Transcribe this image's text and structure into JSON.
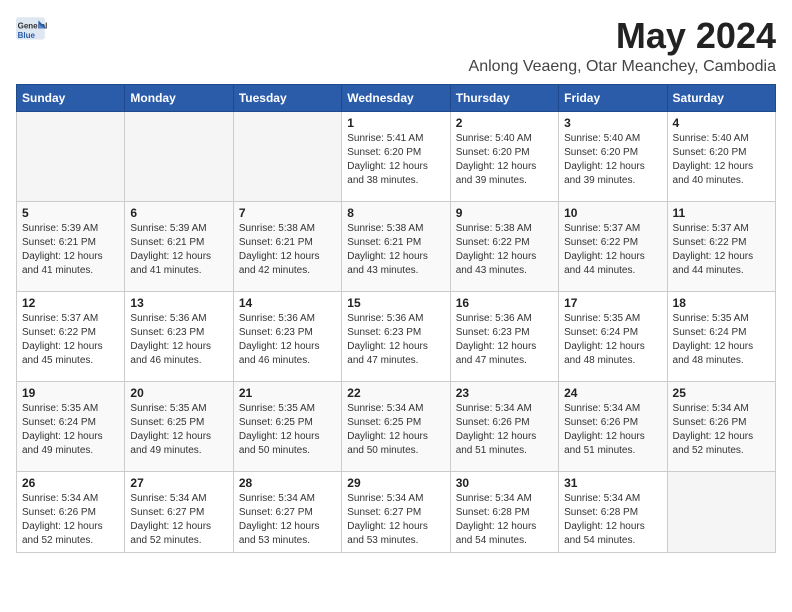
{
  "header": {
    "logo_general": "General",
    "logo_blue": "Blue",
    "title": "May 2024",
    "location": "Anlong Veaeng, Otar Meanchey, Cambodia"
  },
  "weekdays": [
    "Sunday",
    "Monday",
    "Tuesday",
    "Wednesday",
    "Thursday",
    "Friday",
    "Saturday"
  ],
  "weeks": [
    [
      {
        "day": "",
        "sunrise": "",
        "sunset": "",
        "daylight": ""
      },
      {
        "day": "",
        "sunrise": "",
        "sunset": "",
        "daylight": ""
      },
      {
        "day": "",
        "sunrise": "",
        "sunset": "",
        "daylight": ""
      },
      {
        "day": "1",
        "sunrise": "Sunrise: 5:41 AM",
        "sunset": "Sunset: 6:20 PM",
        "daylight": "Daylight: 12 hours and 38 minutes."
      },
      {
        "day": "2",
        "sunrise": "Sunrise: 5:40 AM",
        "sunset": "Sunset: 6:20 PM",
        "daylight": "Daylight: 12 hours and 39 minutes."
      },
      {
        "day": "3",
        "sunrise": "Sunrise: 5:40 AM",
        "sunset": "Sunset: 6:20 PM",
        "daylight": "Daylight: 12 hours and 39 minutes."
      },
      {
        "day": "4",
        "sunrise": "Sunrise: 5:40 AM",
        "sunset": "Sunset: 6:20 PM",
        "daylight": "Daylight: 12 hours and 40 minutes."
      }
    ],
    [
      {
        "day": "5",
        "sunrise": "Sunrise: 5:39 AM",
        "sunset": "Sunset: 6:21 PM",
        "daylight": "Daylight: 12 hours and 41 minutes."
      },
      {
        "day": "6",
        "sunrise": "Sunrise: 5:39 AM",
        "sunset": "Sunset: 6:21 PM",
        "daylight": "Daylight: 12 hours and 41 minutes."
      },
      {
        "day": "7",
        "sunrise": "Sunrise: 5:38 AM",
        "sunset": "Sunset: 6:21 PM",
        "daylight": "Daylight: 12 hours and 42 minutes."
      },
      {
        "day": "8",
        "sunrise": "Sunrise: 5:38 AM",
        "sunset": "Sunset: 6:21 PM",
        "daylight": "Daylight: 12 hours and 43 minutes."
      },
      {
        "day": "9",
        "sunrise": "Sunrise: 5:38 AM",
        "sunset": "Sunset: 6:22 PM",
        "daylight": "Daylight: 12 hours and 43 minutes."
      },
      {
        "day": "10",
        "sunrise": "Sunrise: 5:37 AM",
        "sunset": "Sunset: 6:22 PM",
        "daylight": "Daylight: 12 hours and 44 minutes."
      },
      {
        "day": "11",
        "sunrise": "Sunrise: 5:37 AM",
        "sunset": "Sunset: 6:22 PM",
        "daylight": "Daylight: 12 hours and 44 minutes."
      }
    ],
    [
      {
        "day": "12",
        "sunrise": "Sunrise: 5:37 AM",
        "sunset": "Sunset: 6:22 PM",
        "daylight": "Daylight: 12 hours and 45 minutes."
      },
      {
        "day": "13",
        "sunrise": "Sunrise: 5:36 AM",
        "sunset": "Sunset: 6:23 PM",
        "daylight": "Daylight: 12 hours and 46 minutes."
      },
      {
        "day": "14",
        "sunrise": "Sunrise: 5:36 AM",
        "sunset": "Sunset: 6:23 PM",
        "daylight": "Daylight: 12 hours and 46 minutes."
      },
      {
        "day": "15",
        "sunrise": "Sunrise: 5:36 AM",
        "sunset": "Sunset: 6:23 PM",
        "daylight": "Daylight: 12 hours and 47 minutes."
      },
      {
        "day": "16",
        "sunrise": "Sunrise: 5:36 AM",
        "sunset": "Sunset: 6:23 PM",
        "daylight": "Daylight: 12 hours and 47 minutes."
      },
      {
        "day": "17",
        "sunrise": "Sunrise: 5:35 AM",
        "sunset": "Sunset: 6:24 PM",
        "daylight": "Daylight: 12 hours and 48 minutes."
      },
      {
        "day": "18",
        "sunrise": "Sunrise: 5:35 AM",
        "sunset": "Sunset: 6:24 PM",
        "daylight": "Daylight: 12 hours and 48 minutes."
      }
    ],
    [
      {
        "day": "19",
        "sunrise": "Sunrise: 5:35 AM",
        "sunset": "Sunset: 6:24 PM",
        "daylight": "Daylight: 12 hours and 49 minutes."
      },
      {
        "day": "20",
        "sunrise": "Sunrise: 5:35 AM",
        "sunset": "Sunset: 6:25 PM",
        "daylight": "Daylight: 12 hours and 49 minutes."
      },
      {
        "day": "21",
        "sunrise": "Sunrise: 5:35 AM",
        "sunset": "Sunset: 6:25 PM",
        "daylight": "Daylight: 12 hours and 50 minutes."
      },
      {
        "day": "22",
        "sunrise": "Sunrise: 5:34 AM",
        "sunset": "Sunset: 6:25 PM",
        "daylight": "Daylight: 12 hours and 50 minutes."
      },
      {
        "day": "23",
        "sunrise": "Sunrise: 5:34 AM",
        "sunset": "Sunset: 6:26 PM",
        "daylight": "Daylight: 12 hours and 51 minutes."
      },
      {
        "day": "24",
        "sunrise": "Sunrise: 5:34 AM",
        "sunset": "Sunset: 6:26 PM",
        "daylight": "Daylight: 12 hours and 51 minutes."
      },
      {
        "day": "25",
        "sunrise": "Sunrise: 5:34 AM",
        "sunset": "Sunset: 6:26 PM",
        "daylight": "Daylight: 12 hours and 52 minutes."
      }
    ],
    [
      {
        "day": "26",
        "sunrise": "Sunrise: 5:34 AM",
        "sunset": "Sunset: 6:26 PM",
        "daylight": "Daylight: 12 hours and 52 minutes."
      },
      {
        "day": "27",
        "sunrise": "Sunrise: 5:34 AM",
        "sunset": "Sunset: 6:27 PM",
        "daylight": "Daylight: 12 hours and 52 minutes."
      },
      {
        "day": "28",
        "sunrise": "Sunrise: 5:34 AM",
        "sunset": "Sunset: 6:27 PM",
        "daylight": "Daylight: 12 hours and 53 minutes."
      },
      {
        "day": "29",
        "sunrise": "Sunrise: 5:34 AM",
        "sunset": "Sunset: 6:27 PM",
        "daylight": "Daylight: 12 hours and 53 minutes."
      },
      {
        "day": "30",
        "sunrise": "Sunrise: 5:34 AM",
        "sunset": "Sunset: 6:28 PM",
        "daylight": "Daylight: 12 hours and 54 minutes."
      },
      {
        "day": "31",
        "sunrise": "Sunrise: 5:34 AM",
        "sunset": "Sunset: 6:28 PM",
        "daylight": "Daylight: 12 hours and 54 minutes."
      },
      {
        "day": "",
        "sunrise": "",
        "sunset": "",
        "daylight": ""
      }
    ]
  ]
}
